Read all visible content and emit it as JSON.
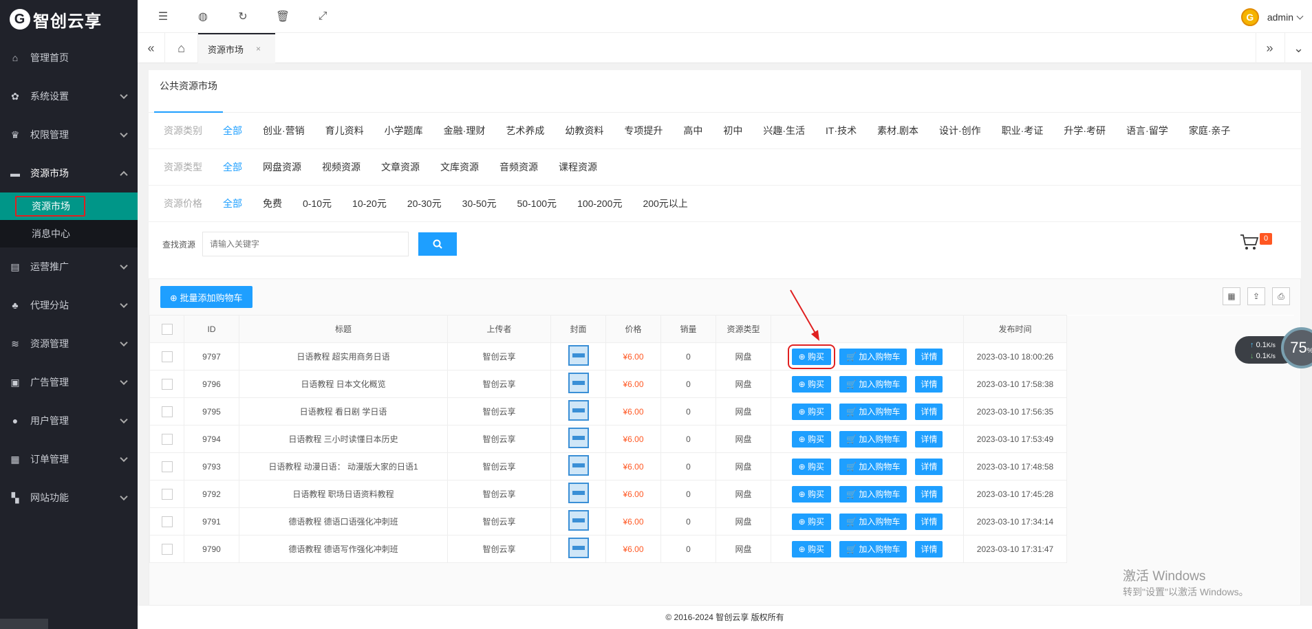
{
  "brand": {
    "logo_text": "智创云享"
  },
  "sidebar": {
    "items": [
      {
        "label": "管理首页",
        "icon": "home-icon",
        "glyph": "⌂"
      },
      {
        "label": "系统设置",
        "icon": "gear-icon",
        "glyph": "✿"
      },
      {
        "label": "权限管理",
        "icon": "key-icon",
        "glyph": "♛"
      },
      {
        "label": "资源市场",
        "icon": "store-icon",
        "glyph": "▬",
        "open": true,
        "children": [
          {
            "label": "资源市场",
            "active": true
          },
          {
            "label": "消息中心"
          }
        ]
      },
      {
        "label": "运营推广",
        "icon": "flag-icon",
        "glyph": "▤"
      },
      {
        "label": "代理分站",
        "icon": "users-icon",
        "glyph": "♣"
      },
      {
        "label": "资源管理",
        "icon": "layers-icon",
        "glyph": "≋"
      },
      {
        "label": "广告管理",
        "icon": "ad-icon",
        "glyph": "▣"
      },
      {
        "label": "用户管理",
        "icon": "user-icon",
        "glyph": "●"
      },
      {
        "label": "订单管理",
        "icon": "clipboard-icon",
        "glyph": "▦"
      },
      {
        "label": "网站功能",
        "icon": "grid-icon",
        "glyph": "▚"
      }
    ]
  },
  "header": {
    "icons": [
      {
        "name": "menu-fold-icon",
        "glyph": "☰"
      },
      {
        "name": "globe-icon",
        "glyph": "◍"
      },
      {
        "name": "refresh-icon",
        "glyph": "↻"
      },
      {
        "name": "trash-icon",
        "glyph": "🗑"
      },
      {
        "name": "fullscreen-icon",
        "glyph": "⤢"
      }
    ],
    "user": "admin",
    "avatar_letter": "G"
  },
  "tabs": {
    "active": "资源市场",
    "close": "×"
  },
  "card": {
    "title": "公共资源市场"
  },
  "filters": [
    {
      "label": "资源类别",
      "options": [
        "全部",
        "创业·营销",
        "育儿资料",
        "小学题库",
        "金融·理财",
        "艺术养成",
        "幼教资料",
        "专项提升",
        "高中",
        "初中",
        "兴趣·生活",
        "IT·技术",
        "素材.剧本",
        "设计·创作",
        "职业·考证",
        "升学·考研",
        "语言·留学",
        "家庭·亲子"
      ],
      "active": 0
    },
    {
      "label": "资源类型",
      "options": [
        "全部",
        "网盘资源",
        "视频资源",
        "文章资源",
        "文库资源",
        "音频资源",
        "课程资源"
      ],
      "active": 0
    },
    {
      "label": "资源价格",
      "options": [
        "全部",
        "免费",
        "0-10元",
        "10-20元",
        "20-30元",
        "30-50元",
        "50-100元",
        "100-200元",
        "200元以上"
      ],
      "active": 0
    }
  ],
  "search": {
    "label": "查找资源",
    "placeholder": "请输入关键字"
  },
  "cart": {
    "count": "0"
  },
  "toolbar": {
    "batch_label": "⊕ 批量添加购物车"
  },
  "table": {
    "headers": [
      "ID",
      "标题",
      "上传者",
      "封面",
      "价格",
      "销量",
      "资源类型",
      "",
      "发布时间"
    ],
    "buttons": {
      "buy": "⊕ 购买",
      "cart": "🛒 加入购物车",
      "detail": "详情"
    },
    "rows": [
      {
        "id": "9797",
        "title": "日语教程 超实用商务日语",
        "uploader": "智创云享",
        "price": "¥6.00",
        "sales": "0",
        "type": "网盘",
        "time": "2023-03-10 18:00:26"
      },
      {
        "id": "9796",
        "title": "日语教程 日本文化概览",
        "uploader": "智创云享",
        "price": "¥6.00",
        "sales": "0",
        "type": "网盘",
        "time": "2023-03-10 17:58:38"
      },
      {
        "id": "9795",
        "title": "日语教程 看日剧 学日语",
        "uploader": "智创云享",
        "price": "¥6.00",
        "sales": "0",
        "type": "网盘",
        "time": "2023-03-10 17:56:35"
      },
      {
        "id": "9794",
        "title": "日语教程 三小时读懂日本历史",
        "uploader": "智创云享",
        "price": "¥6.00",
        "sales": "0",
        "type": "网盘",
        "time": "2023-03-10 17:53:49"
      },
      {
        "id": "9793",
        "title": "日语教程 动漫日语： 动漫版大家的日语1",
        "uploader": "智创云享",
        "price": "¥6.00",
        "sales": "0",
        "type": "网盘",
        "time": "2023-03-10 17:48:58"
      },
      {
        "id": "9792",
        "title": "日语教程 职场日语资料教程",
        "uploader": "智创云享",
        "price": "¥6.00",
        "sales": "0",
        "type": "网盘",
        "time": "2023-03-10 17:45:28"
      },
      {
        "id": "9791",
        "title": "德语教程 德语口语强化冲刺班",
        "uploader": "智创云享",
        "price": "¥6.00",
        "sales": "0",
        "type": "网盘",
        "time": "2023-03-10 17:34:14"
      },
      {
        "id": "9790",
        "title": "德语教程 德语写作强化冲刺班",
        "uploader": "智创云享",
        "price": "¥6.00",
        "sales": "0",
        "type": "网盘",
        "time": "2023-03-10 17:31:47"
      }
    ]
  },
  "footer": {
    "text": "© 2016-2024 智创云享 版权所有"
  },
  "watermark": {
    "line1": "激活 Windows",
    "line2": "转到\"设置\"以激活 Windows。"
  },
  "net": {
    "up": "0.1",
    "down": "0.1",
    "unit": "K/s",
    "percent": "75",
    "pct_sign": "%"
  },
  "colors": {
    "accent": "#1e9fff",
    "sidebar": "#20222a",
    "active": "#009688",
    "price": "#ff5722"
  }
}
